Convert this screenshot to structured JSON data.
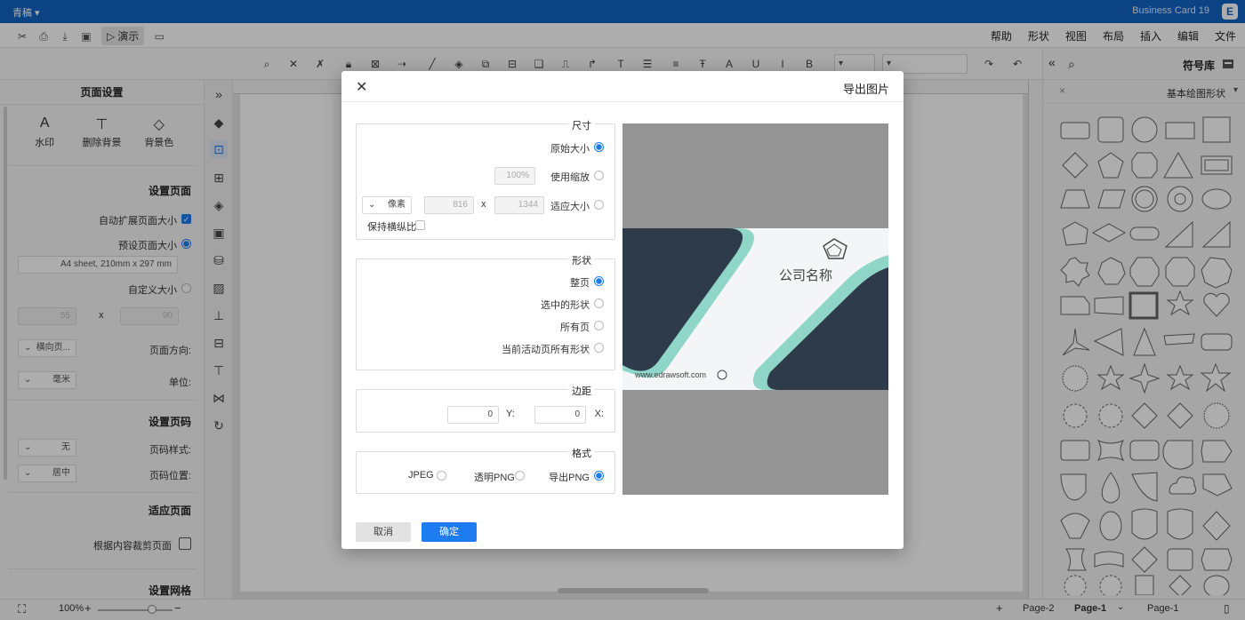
{
  "titlebar": {
    "doc_title": "Business Card 19",
    "user": "青稿",
    "logo": "E"
  },
  "menubar": {
    "menus": [
      "文件",
      "编辑",
      "插入",
      "布局",
      "视图",
      "形状",
      "帮助"
    ],
    "present_label": "演示"
  },
  "shape_library": {
    "title": "符号库",
    "category": "基本绘图形状"
  },
  "settings": {
    "panel_title": "页面设置",
    "tools": [
      {
        "label": "背景色",
        "icon": "paint-bucket-icon"
      },
      {
        "label": "删除背景",
        "icon": "remove-background-icon"
      },
      {
        "label": "水印",
        "icon": "watermark-icon"
      }
    ],
    "page_section": "设置页面",
    "auto_extend": "自动扩展页面大小",
    "preset_size": "预设页面大小",
    "preset_value": "A4 sheet, 210mm x 297 mm",
    "custom_size": "自定义大小",
    "custom_w": "90",
    "custom_h": "55",
    "x": "x",
    "orientation_label": "页面方向:",
    "orientation_value": "横向页...",
    "unit_label": "单位:",
    "unit_value": "毫米",
    "pagenum_section": "设置页码",
    "pagenum_style_label": "页码样式:",
    "pagenum_style_value": "无",
    "pagenum_pos_label": "页码位置:",
    "pagenum_pos_value": "居中",
    "fit_section": "适应页面",
    "fit_content": "根据内容裁剪页面",
    "grid_section": "设置网格"
  },
  "dialog": {
    "title": "导出图片",
    "size_group": "尺寸",
    "original_size": "原始大小",
    "use_scale": "使用缩放",
    "scale_value": "100%",
    "fit_size": "适应大小",
    "width_value": "1344",
    "height_value": "816",
    "x": "x",
    "unit_value": "像素",
    "keep_ratio": "保持横纵比",
    "shape_group": "形状",
    "whole_page": "整页",
    "selected_shapes": "选中的形状",
    "all_pages": "所有页",
    "current_active": "当前活动页所有形状",
    "margin_group": "边距",
    "margin_x_label": "X:",
    "margin_x": "0",
    "margin_y_label": "Y:",
    "margin_y": "0",
    "format_group": "格式",
    "export_png": "导出PNG",
    "transparent_png": "透明PNG",
    "jpeg": "JPEG",
    "ok": "确定",
    "cancel": "取消",
    "card_company": "公司名称",
    "card_url": "www.edrawsoft.com"
  },
  "statusbar": {
    "page_tab_active": "Page-1",
    "page_tab_2": "Page-2",
    "page_tab_left": "Page-1",
    "zoom": "100%"
  },
  "colors": {
    "brand": "#1264c4",
    "accent": "#1d7cf2",
    "card_dark": "#2d3b4a",
    "card_teal": "#8fd6c9"
  }
}
